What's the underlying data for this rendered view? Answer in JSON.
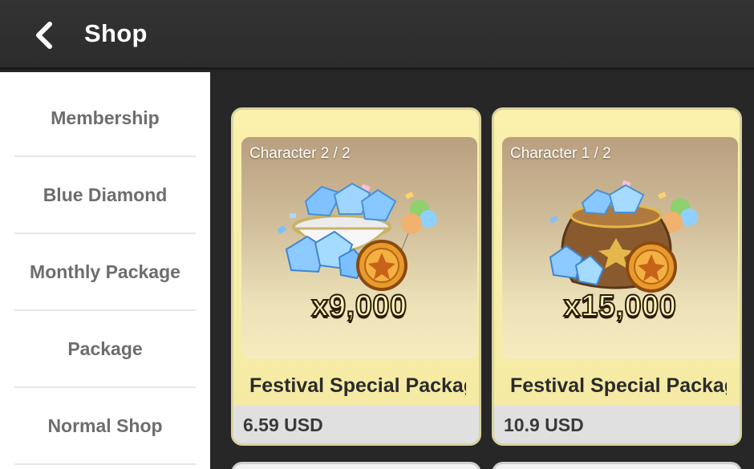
{
  "header": {
    "title": "Shop"
  },
  "sidebar": {
    "items": [
      {
        "label": "Membership"
      },
      {
        "label": "Blue Diamond"
      },
      {
        "label": "Monthly Package"
      },
      {
        "label": "Package"
      },
      {
        "label": "Normal Shop"
      }
    ]
  },
  "products": [
    {
      "tag": "Character 2 / 2",
      "quantity": "x9,000",
      "name": "Festival Special Package",
      "price": "6.59 USD"
    },
    {
      "tag": "Character 1 / 2",
      "quantity": "x15,000",
      "name": "Festival Special Package",
      "price": "10.9 USD"
    }
  ],
  "icons": {
    "back": "chevron-left-icon"
  },
  "colors": {
    "card_bg": "#fbf1ad",
    "topbar_bg": "#333333",
    "sidebar_text": "#6d6d6d"
  }
}
